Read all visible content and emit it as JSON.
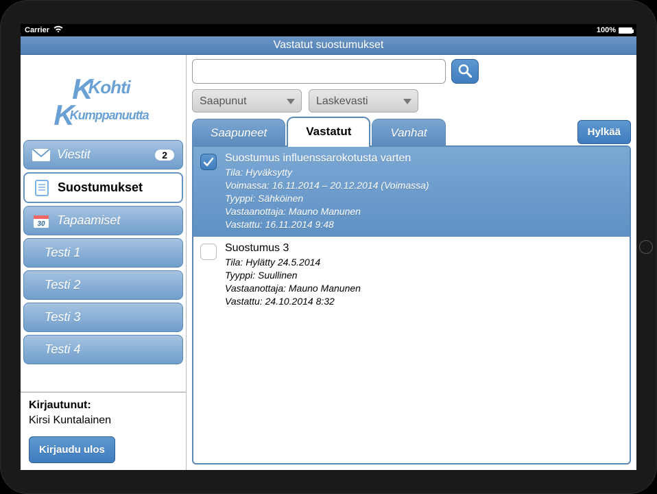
{
  "statusbar": {
    "carrier": "Carrier",
    "battery": "100%"
  },
  "header": {
    "title": "Vastatut suostumukset"
  },
  "logo": {
    "line1": "Kohti",
    "line2": "Kumppanuutta"
  },
  "sidebar": {
    "items": [
      {
        "icon": "mail",
        "label": "Viestit",
        "badge": "2"
      },
      {
        "icon": "document",
        "label": "Suostumukset",
        "active": true
      },
      {
        "icon": "calendar",
        "label": "Tapaamiset"
      },
      {
        "label": "Testi 1",
        "sub": true
      },
      {
        "label": "Testi 2",
        "sub": true
      },
      {
        "label": "Testi 3",
        "sub": true
      },
      {
        "label": "Testi 4",
        "sub": true
      }
    ],
    "footer": {
      "label": "Kirjautunut:",
      "user": "Kirsi Kuntalainen",
      "logout": "Kirjaudu ulos"
    }
  },
  "search": {
    "value": "",
    "placeholder": ""
  },
  "filters": {
    "sort_field": "Saapunut",
    "sort_dir": "Laskevasti"
  },
  "tabs": [
    {
      "label": "Saapuneet"
    },
    {
      "label": "Vastatut",
      "active": true
    },
    {
      "label": "Vanhat"
    }
  ],
  "reject_label": "Hylkää",
  "rows": [
    {
      "checked": true,
      "title": "Suostumus influenssarokotusta varten",
      "status": "Tila: Hyväksytty",
      "valid": "Voimassa: 16.11.2014 – 20.12.2014 (Voimassa)",
      "type": "Tyyppi: Sähköinen",
      "receiver": "Vastaanottaja: Mauno Manunen",
      "answered": "Vastattu: 16.11.2014 9:48"
    },
    {
      "checked": false,
      "title": "Suostumus 3",
      "status": "Tila: Hylätty 24.5.2014",
      "type": "Tyyppi: Suullinen",
      "receiver": "Vastaanottaja: Mauno Manunen",
      "answered": "Vastattu: 24.10.2014 8:32"
    }
  ]
}
